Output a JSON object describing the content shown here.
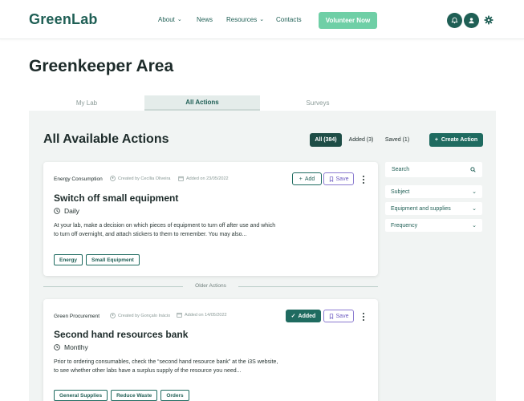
{
  "header": {
    "logo": "GreenLab",
    "nav": [
      "About",
      "News",
      "Resources",
      "Contacts"
    ],
    "volunteer_label": "Volunteer Now"
  },
  "page": {
    "title": "Greenkeeper Area",
    "tabs": [
      "My Lab",
      "All Actions",
      "Surveys"
    ],
    "active_tab": "All Actions"
  },
  "actions": {
    "title": "All Available Actions",
    "filters": [
      "All (384)",
      "Added (3)",
      "Saved (1)"
    ],
    "create_label": "Create Action",
    "older_label": "Older Actions"
  },
  "cards": [
    {
      "category": "Energy Consumption",
      "created_by": "Created by Cecília Oliveira",
      "added_on": "Added on 23/05/2022",
      "title": "Switch off small equipment",
      "frequency": "Daily",
      "description": "At your lab, make a decision on which pieces of equipment to turn off after use and which to turn off overnight, and attach stickers to them to remember. You may also...",
      "tags": [
        "Energy",
        "Small Equipment"
      ],
      "primary_label": "Add",
      "save_label": "Save",
      "added": false
    },
    {
      "category": "Green Procurement",
      "created_by": "Created by Gonçalo Inácio",
      "added_on": "Added on 14/05/2022",
      "title": "Second hand resources bank",
      "frequency": "Montlhy",
      "description": "Prior to ordering consumables, check the “second hand resource bank” at the i3S website, to see whether other labs have a surplus supply of the resource you need...",
      "tags": [
        "General Supplies",
        "Reduce Waste",
        "Orders"
      ],
      "primary_label": "Added",
      "save_label": "Save",
      "added": true
    }
  ],
  "sidebar": {
    "search_placeholder": "Search",
    "filters": [
      "Subject",
      "Equipment and supplies",
      "Frequency"
    ]
  },
  "colors": {
    "brand": "#1f5f55",
    "accent": "#6fcfa6",
    "save": "#6a58c0"
  }
}
